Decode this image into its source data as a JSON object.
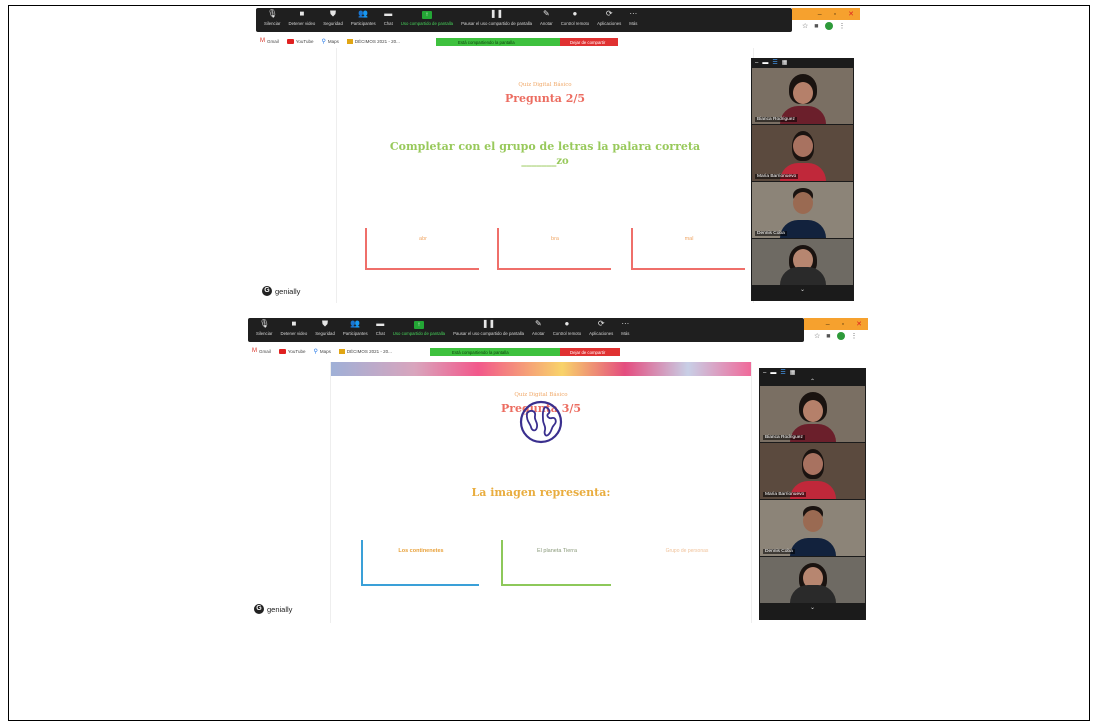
{
  "toolbar": {
    "buttons": [
      {
        "label": "Silenciar",
        "icon": "microphone-icon"
      },
      {
        "label": "Detener video",
        "icon": "video-camera-icon"
      },
      {
        "label": "Seguridad",
        "icon": "shield-icon"
      },
      {
        "label": "Participantes",
        "icon": "participants-icon",
        "count": "11"
      },
      {
        "label": "Chat",
        "icon": "chat-icon"
      },
      {
        "label": "Uso compartido de pantalla",
        "icon": "share-screen-icon"
      },
      {
        "label": "Pausar el uso compartido de pantalla",
        "icon": "pause-icon"
      },
      {
        "label": "Anotar",
        "icon": "pencil-icon"
      },
      {
        "label": "Control remoto",
        "icon": "mouse-icon"
      },
      {
        "label": "Aplicaciones",
        "icon": "apps-icon"
      },
      {
        "label": "Más",
        "icon": "more-icon"
      }
    ],
    "sharing_banner": "Está compartiendo la pantalla",
    "stop_sharing": "Dejar de compartir"
  },
  "window_controls": {
    "minimize": "–",
    "maximize": "▫",
    "close": "✕"
  },
  "bookmarks": [
    {
      "label": "Gmail",
      "icon": "gmail-icon"
    },
    {
      "label": "YouTube",
      "icon": "youtube-icon"
    },
    {
      "label": "Maps",
      "icon": "maps-icon"
    },
    {
      "label": "DÉCIMOS 2021 - 20...",
      "icon": "folder-icon"
    }
  ],
  "slide1": {
    "kicker": "Quiz Digital Básico",
    "title": "Pregunta 2/5",
    "prompt": "Completar con el grupo de letras la palara correta",
    "blank": "_______zo",
    "options": [
      "abr",
      "bra",
      "mal"
    ],
    "brand": "genially"
  },
  "slide2": {
    "kicker": "Quiz Digital Básico",
    "title": "Pregunta 3/5",
    "prompt": "La imagen representa:",
    "options": [
      "Los continenetes",
      "El planeta Tierra",
      "Grupo de personas"
    ],
    "brand": "genially"
  },
  "participants": [
    "Bianca Rodriguez",
    "Maria Barrionuevo",
    "Dennis Coba",
    ""
  ],
  "colors": {
    "accent_red": "#ec6d61",
    "prompt_green": "#98c95b",
    "kicker_orange": "#f0a868",
    "zoom_green": "#23a635",
    "stop_red": "#e03131",
    "globe": "#3a2f8e"
  }
}
